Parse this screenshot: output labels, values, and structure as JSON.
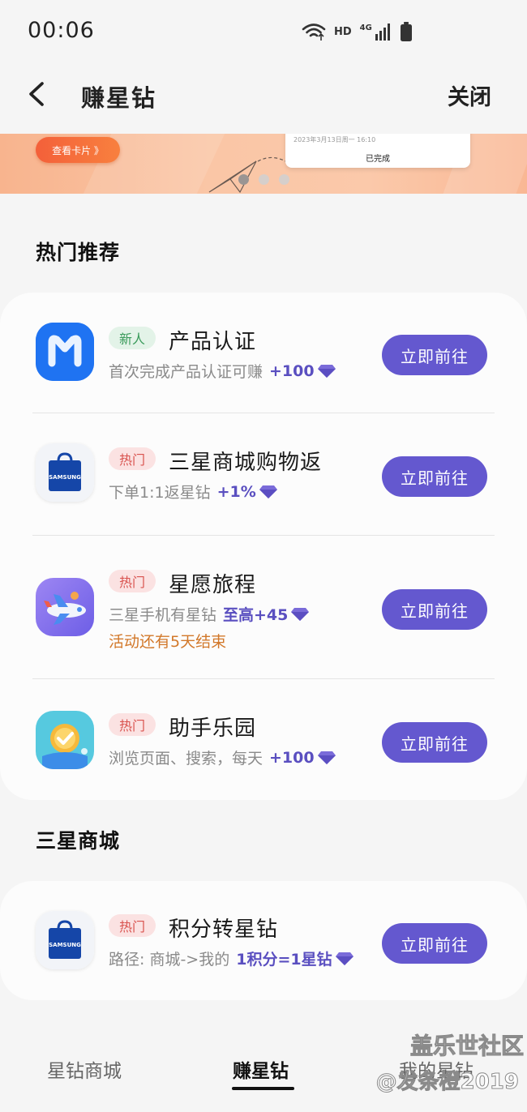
{
  "status_bar": {
    "time": "00:06",
    "network": "HD",
    "cellular": "4G",
    "icons": [
      "wifi-icon",
      "signal-icon",
      "battery-icon"
    ]
  },
  "header": {
    "back_icon": "chevron-left-icon",
    "title": "赚星钻",
    "close_label": "关闭"
  },
  "banner": {
    "button_label": "查看卡片 》",
    "card_date": "2023年3月13日周一 16:10",
    "card_status": "已完成",
    "slide_count": 3,
    "active_slide": 1
  },
  "sections": {
    "popular_title": "热门推荐",
    "store_title": "三星商城"
  },
  "popular_items": [
    {
      "icon": "samsung-members-icon",
      "tag": "新人",
      "title": "产品认证",
      "desc": "首次完成产品认证可赚",
      "reward": "+100",
      "note": "",
      "button": "立即前往"
    },
    {
      "icon": "samsung-shop-bag-icon",
      "tag": "热门",
      "title": "三星商城购物返",
      "desc": "下单1:1返星钻",
      "reward": "+1%",
      "note": "",
      "button": "立即前往"
    },
    {
      "icon": "airplane-journey-icon",
      "tag": "热门",
      "title": "星愿旅程",
      "desc": "三星手机有星钻",
      "reward": "至高+45",
      "note": "活动还有5天结束",
      "button": "立即前往"
    },
    {
      "icon": "assistant-park-icon",
      "tag": "热门",
      "title": "助手乐园",
      "desc": "浏览页面、搜索，每天",
      "reward": "+100",
      "note": "",
      "button": "立即前往"
    }
  ],
  "store_items": [
    {
      "icon": "samsung-shop-bag-icon",
      "tag": "热门",
      "title": "积分转星钻",
      "desc": "路径: 商城->我的",
      "reward": "1积分=1星钻",
      "note": "",
      "button": "立即前往"
    }
  ],
  "bag_label": "SAMSUNG",
  "bottom_nav": {
    "tabs": [
      "星钻商城",
      "赚星钻",
      "我的星钻"
    ],
    "active_tab": "赚星钻"
  },
  "watermark": {
    "line1": "盖乐世社区",
    "line2": "@发条橙2019"
  },
  "colors": {
    "accent": "#6458cf",
    "reward": "#5a4fc0",
    "note": "#d2782a",
    "tag_new_bg": "#e3f3e8",
    "tag_hot_bg": "#fbe2e2",
    "banner": "#f9b794"
  }
}
